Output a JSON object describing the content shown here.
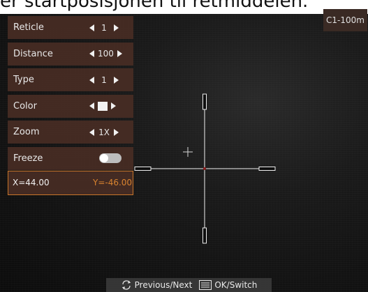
{
  "header": {
    "partial_text": "er startposisjonen til retmiddelen."
  },
  "channel_badge": "C1-100m",
  "menu": {
    "items": [
      {
        "label": "Reticle",
        "value": "1",
        "kind": "stepper"
      },
      {
        "label": "Distance",
        "value": "100",
        "kind": "stepper"
      },
      {
        "label": "Type",
        "value": "1",
        "kind": "stepper"
      },
      {
        "label": "Color",
        "value": "",
        "kind": "color",
        "swatch_color": "#f2f2f2"
      },
      {
        "label": "Zoom",
        "value": "1X",
        "kind": "stepper"
      },
      {
        "label": "Freeze",
        "kind": "toggle",
        "state": "off"
      }
    ]
  },
  "coords": {
    "x": "X=44.00",
    "y": "Y=-46.00"
  },
  "footer": {
    "previous_next": "Previous/Next",
    "ok_switch": "OK/Switch"
  },
  "colors": {
    "menu_bg": "#482c24",
    "highlight_border": "#c8752a",
    "y_text": "#d8832f",
    "reticle": "#f0f0f0",
    "reticle_center": "#8b1e1e"
  }
}
